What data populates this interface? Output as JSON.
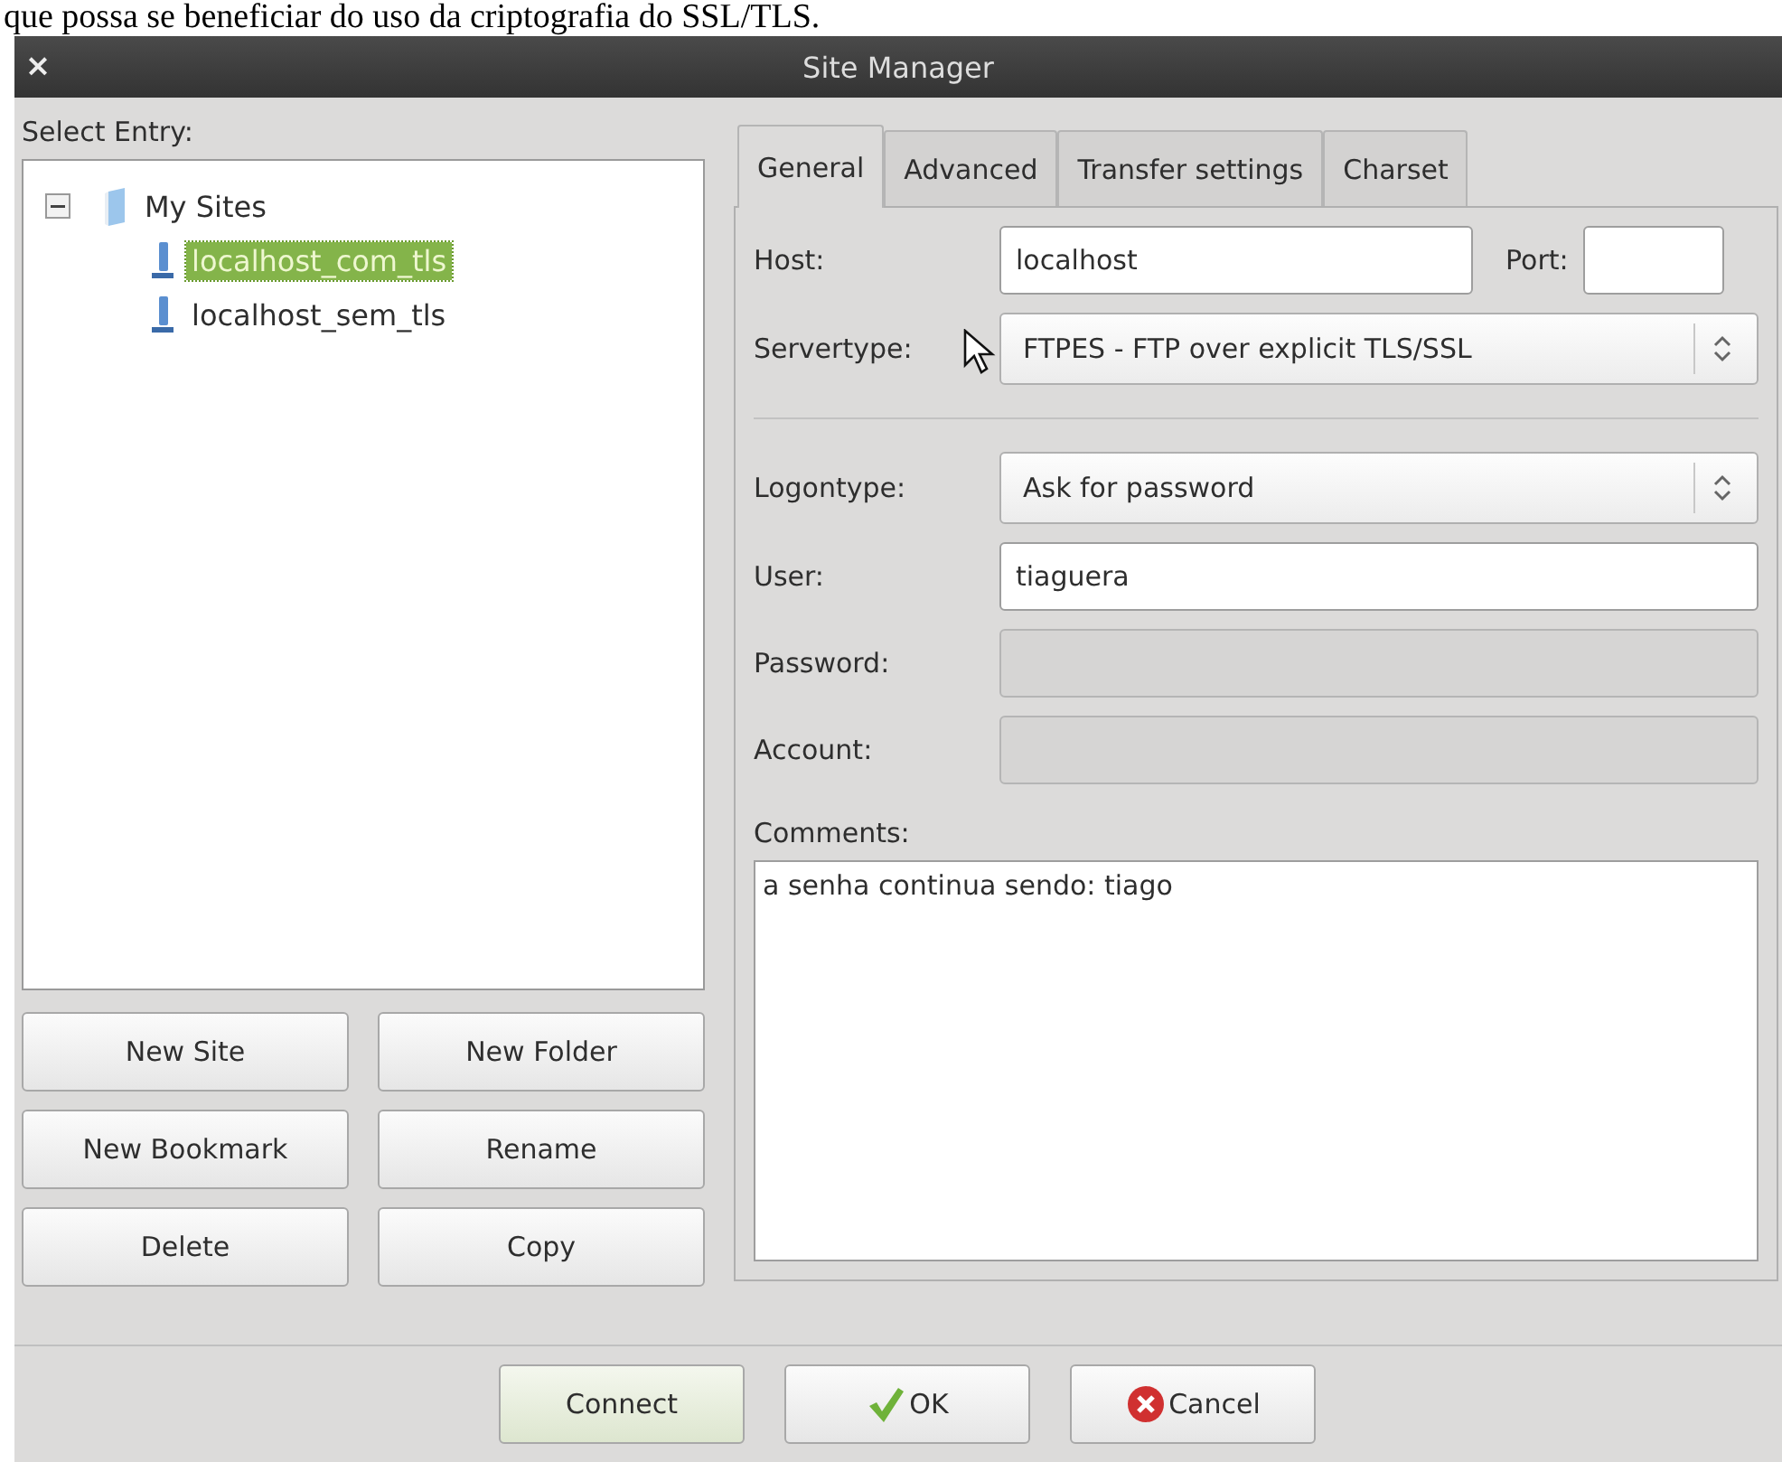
{
  "caption": "que possa se beneficiar do uso da criptografia do SSL/TLS.",
  "window": {
    "title": "Site Manager",
    "close": "×"
  },
  "entry_label": "Select Entry:",
  "tree": [
    {
      "label": "My Sites",
      "kind": "folder",
      "expanded": true,
      "selected": false,
      "children": [
        {
          "label": "localhost_com_tls",
          "kind": "site",
          "selected": true
        },
        {
          "label": "localhost_sem_tls",
          "kind": "site",
          "selected": false
        }
      ]
    }
  ],
  "site_buttons": [
    "New Site",
    "New Folder",
    "New Bookmark",
    "Rename",
    "Delete",
    "Copy"
  ],
  "tabs": [
    {
      "label": "General",
      "selected": true
    },
    {
      "label": "Advanced",
      "selected": false
    },
    {
      "label": "Transfer settings",
      "selected": false
    },
    {
      "label": "Charset",
      "selected": false
    }
  ],
  "host": {
    "label": "Host:",
    "value": "localhost"
  },
  "port": {
    "label": "Port:"
  },
  "fields": [
    {
      "kind": "select",
      "label": "Servertype:",
      "value": "FTPES - FTP over explicit TLS/SSL"
    },
    {
      "kind": "separator"
    },
    {
      "kind": "select",
      "label": "Logontype:",
      "value": "Ask for password"
    },
    {
      "kind": "text",
      "label": "User:",
      "value": "tiaguera",
      "disabled": false
    },
    {
      "kind": "text",
      "label": "Password:",
      "disabled": true
    },
    {
      "kind": "text",
      "label": "Account:",
      "disabled": true
    }
  ],
  "comments": {
    "label": "Comments:",
    "value": "a senha continua sendo: tiago"
  },
  "dialog_buttons": [
    {
      "label": "Connect",
      "kind": "default"
    },
    {
      "label": "OK",
      "kind": "ok"
    },
    {
      "label": "Cancel",
      "kind": "cancel"
    }
  ]
}
